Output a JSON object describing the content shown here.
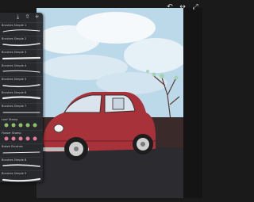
{
  "toolbar": {
    "icons": [
      "undo-icon",
      "redo-icon",
      "expand-icon"
    ],
    "undo": "↶",
    "redo": "↔",
    "expand": "⤢"
  },
  "brush_panel": {
    "header_icons": {
      "import": "⤓",
      "share": "⇧",
      "add": "+"
    },
    "brushes": [
      {
        "name": "Brushes Simple 1",
        "stroke_color": "#e8e8e8"
      },
      {
        "name": "Brushes Simple 2",
        "stroke_color": "#e8e8e8"
      },
      {
        "name": "Brushes Simple 3",
        "stroke_color": "#e8e8e8"
      },
      {
        "name": "Brushes Simple 4",
        "stroke_color": "#e8e8e8"
      },
      {
        "name": "Brushes Simple 5",
        "stroke_color": "#e8e8e8"
      },
      {
        "name": "Brushes Simple 6",
        "stroke_color": "#e8e8e8"
      },
      {
        "name": "Brushes Simple 7",
        "stroke_color": "#e8e8e8"
      },
      {
        "name": "Leaf Stamp",
        "stroke_color": "#8fbf6a"
      },
      {
        "name": "Flower Stamp",
        "stroke_color": "#e07b9a"
      },
      {
        "name": "Bokeh Brushes",
        "stroke_color": "#e8e8e8"
      },
      {
        "name": "Brushes Simple 8",
        "stroke_color": "#e8e8e8"
      },
      {
        "name": "Brushes Simple 9",
        "stroke_color": "#e8e8e8"
      },
      {
        "name": "Brushes Simple 10",
        "stroke_color": "#e8e8e8"
      }
    ]
  },
  "artwork": {
    "sky_color": "#bcd9ea",
    "cloud_color": "#f0f6fa",
    "ground_color": "#3a2a2a",
    "road_color": "#2b2b30",
    "car_color": "#a8323a",
    "car_dark": "#6e1c22"
  }
}
